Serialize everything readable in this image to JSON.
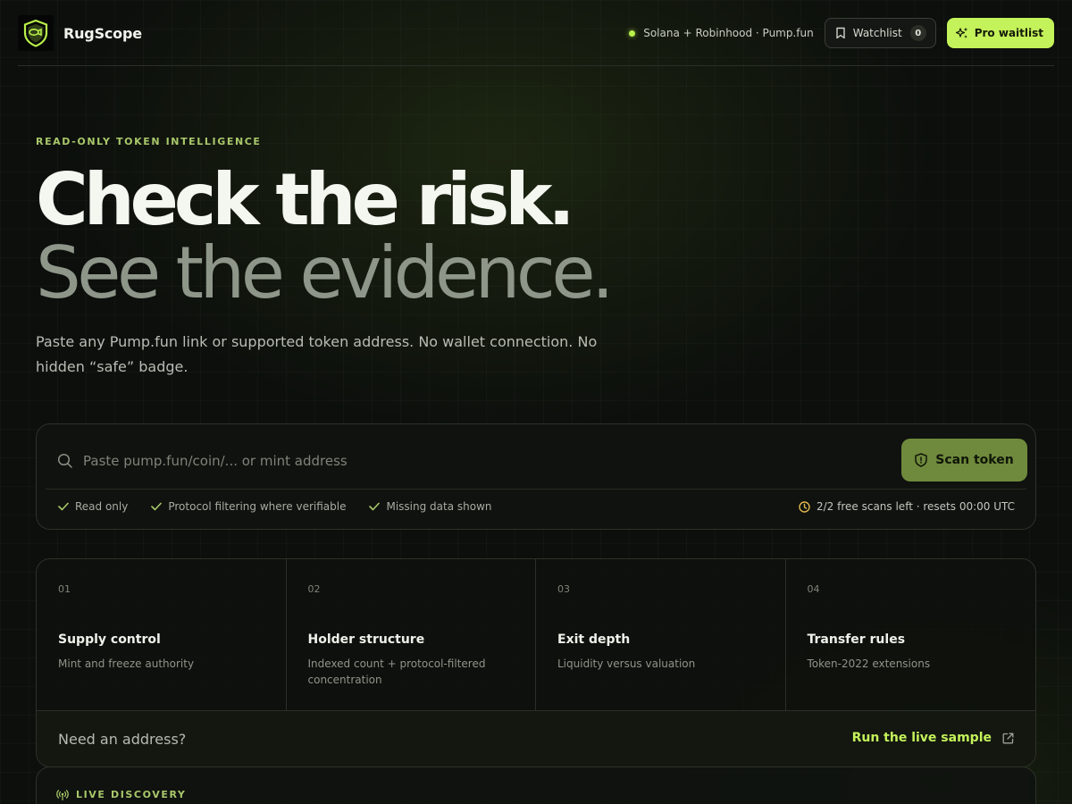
{
  "nav": {
    "brand": "RugScope",
    "network": "Solana + Robinhood · Pump.fun",
    "watchlist_label": "Watchlist",
    "watchlist_count": "0",
    "pro_label": "Pro waitlist"
  },
  "hero": {
    "eyebrow": "READ-ONLY TOKEN INTELLIGENCE",
    "headline": "Check the risk.",
    "subheadline": "See the evidence.",
    "description": "Paste any Pump.fun link or supported token address. No wallet connection. No hidden “safe” badge."
  },
  "search": {
    "placeholder": "Paste pump.fun/coin/... or mint address",
    "button": "Scan token",
    "checks": [
      "Read only",
      "Protocol filtering where verifiable",
      "Missing data shown"
    ],
    "quota": "2/2 free scans left · resets 00:00 UTC"
  },
  "features": {
    "items": [
      {
        "num": "01",
        "title": "Supply control",
        "desc": "Mint and freeze authority"
      },
      {
        "num": "02",
        "title": "Holder structure",
        "desc": "Indexed count + protocol-filtered concentration"
      },
      {
        "num": "03",
        "title": "Exit depth",
        "desc": "Liquidity versus valuation"
      },
      {
        "num": "04",
        "title": "Transfer rules",
        "desc": "Token-2022 extensions"
      }
    ],
    "footer_text": "Need an address?",
    "footer_link": "Run the live sample"
  },
  "discovery": {
    "label": "LIVE DISCOVERY"
  },
  "colors": {
    "accent": "#c4f25a",
    "eyebrow": "#a9c86a",
    "scan_button": "#6f8a3c",
    "background": "#0c0f0c"
  },
  "icons": [
    "shield-logo-icon",
    "bookmark-icon",
    "sparkles-icon",
    "search-icon",
    "shield-icon",
    "check-icon",
    "clock-icon",
    "external-link-icon",
    "broadcast-icon"
  ]
}
